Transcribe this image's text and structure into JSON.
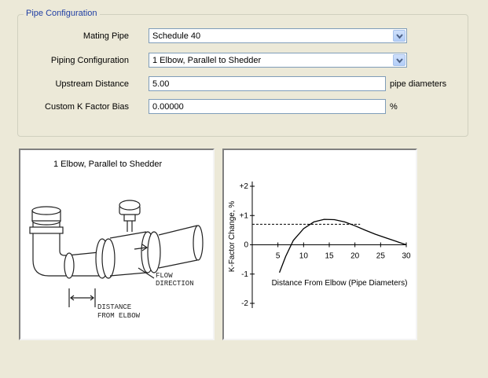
{
  "group": {
    "title": "Pipe Configuration"
  },
  "form": {
    "mating_pipe": {
      "label": "Mating Pipe",
      "value": "Schedule 40"
    },
    "piping_config": {
      "label": "Piping Configuration",
      "value": "1 Elbow, Parallel to Shedder"
    },
    "upstream_distance": {
      "label": "Upstream Distance",
      "value": "5.00",
      "unit": "pipe diameters"
    },
    "k_factor_bias": {
      "label": "Custom K Factor Bias",
      "value": "0.00000",
      "unit": "%"
    }
  },
  "illustration": {
    "caption": "1 Elbow, Parallel to Shedder",
    "flow_label_1": "FLOW",
    "flow_label_2": "DIRECTION",
    "distance_label_1": "DISTANCE",
    "distance_label_2": "FROM ELBOW"
  },
  "chart_data": {
    "type": "line",
    "title": "",
    "xlabel": "Distance From Elbow (Pipe Diameters)",
    "ylabel": "K-Factor Change, %",
    "xlim": [
      0,
      30
    ],
    "ylim": [
      -2,
      2
    ],
    "x_ticks": [
      5,
      10,
      15,
      20,
      25,
      30
    ],
    "x_tick_labels": [
      "5",
      "10",
      "15",
      "20",
      "25",
      "30"
    ],
    "y_ticks": [
      2,
      1,
      0,
      -1,
      -2
    ],
    "y_tick_labels": [
      "+2",
      "+1",
      "0",
      "-1",
      "-2"
    ],
    "series": [
      {
        "x": [
          5.3,
          6.5,
          8,
          10,
          12,
          14,
          16,
          18,
          20,
          22,
          24,
          26,
          28,
          30
        ],
        "y": [
          -0.95,
          -0.4,
          0.15,
          0.55,
          0.78,
          0.87,
          0.86,
          0.78,
          0.65,
          0.5,
          0.36,
          0.24,
          0.12,
          0.0
        ]
      }
    ],
    "reference_line": {
      "y": 0.7,
      "x_start": 0,
      "x_end": 21,
      "style": "dashed"
    }
  }
}
